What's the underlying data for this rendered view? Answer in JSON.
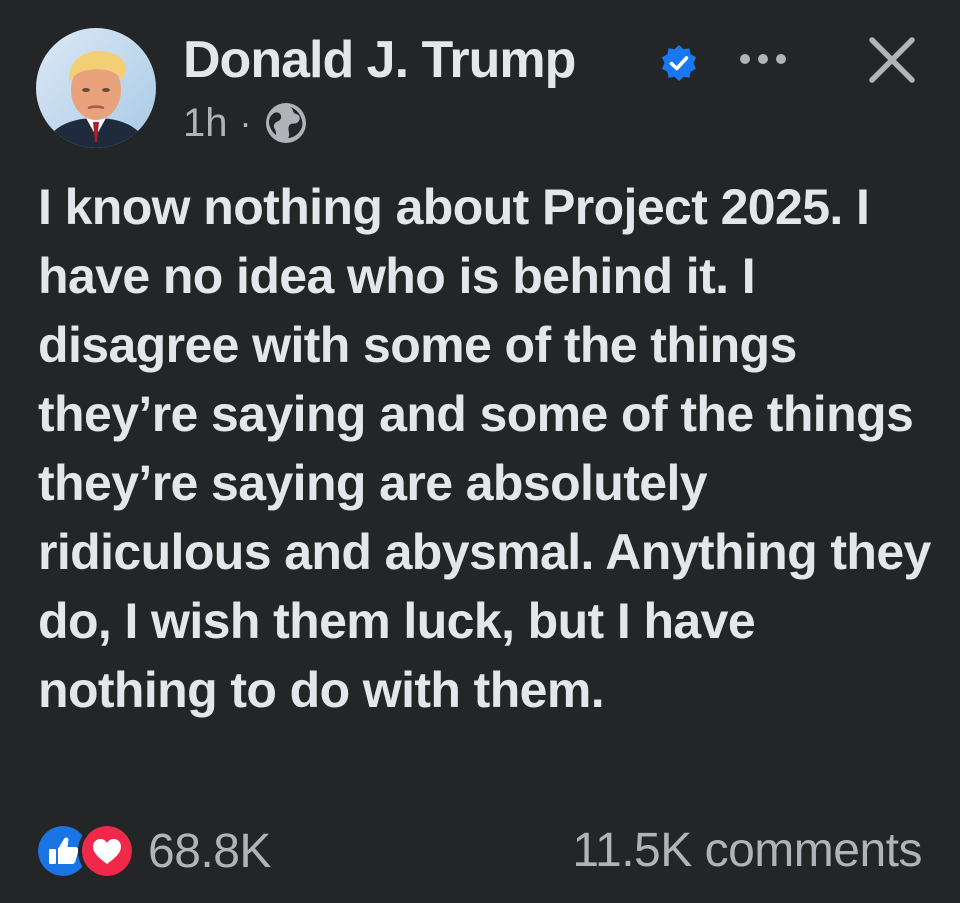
{
  "post": {
    "author": "Donald J. Trump",
    "verified": true,
    "timestamp": "1h",
    "separator": "·",
    "audience_icon": "globe-icon",
    "body": "I know nothing about Project 2025. I have no idea who is behind it. I disagree with some of the things they’re saying and some of the things they’re saying are absolutely ridiculous and abysmal. Anything they do, I wish them luck, but I have nothing to do with them.",
    "reactions": {
      "icons": [
        "like-icon",
        "love-icon"
      ],
      "count": "68.8K"
    },
    "comments": "11.5K comments"
  },
  "colors": {
    "background": "#242526",
    "primary_text": "#e4e6eb",
    "secondary_text": "#b0b3b8",
    "verified_blue": "#1877f2",
    "like_blue": "#1b74e4",
    "love_red": "#f02849"
  }
}
